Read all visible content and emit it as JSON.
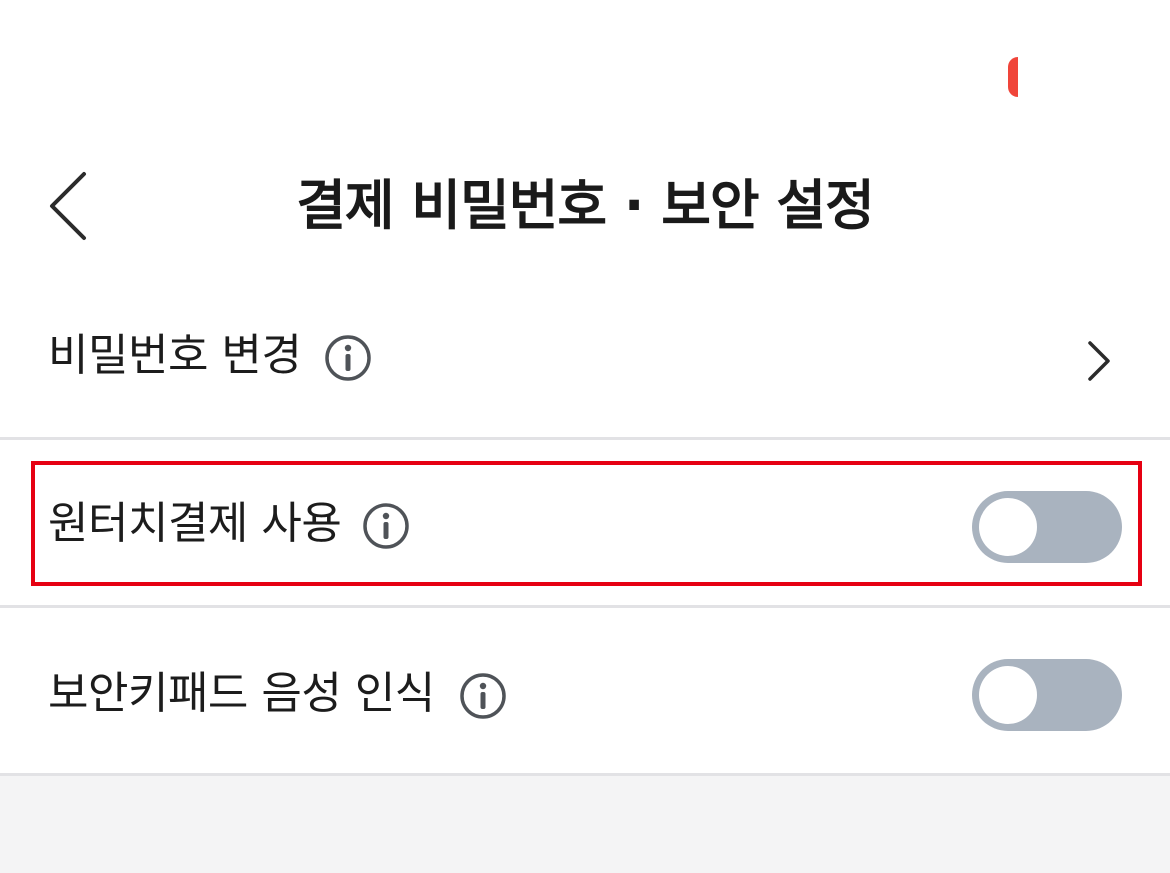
{
  "header": {
    "title": "결제 비밀번호 · 보안 설정",
    "back_icon": "chevron-left-icon"
  },
  "status_bar": {
    "indicator_color": "#f0453a"
  },
  "settings": {
    "change_password": {
      "label": "비밀번호 변경",
      "info_icon": "info-circle-icon",
      "trailing_icon": "chevron-right-icon"
    },
    "one_touch_payment": {
      "label": "원터치결제 사용",
      "info_icon": "info-circle-icon",
      "enabled": false,
      "highlighted": true,
      "highlight_color": "#e60012"
    },
    "keypad_voice": {
      "label": "보안키패드 음성 인식",
      "info_icon": "info-circle-icon",
      "enabled": false
    }
  },
  "colors": {
    "toggle_off": "#a9b3bf",
    "divider": "#e2e2e5",
    "background": "#f4f4f5"
  }
}
